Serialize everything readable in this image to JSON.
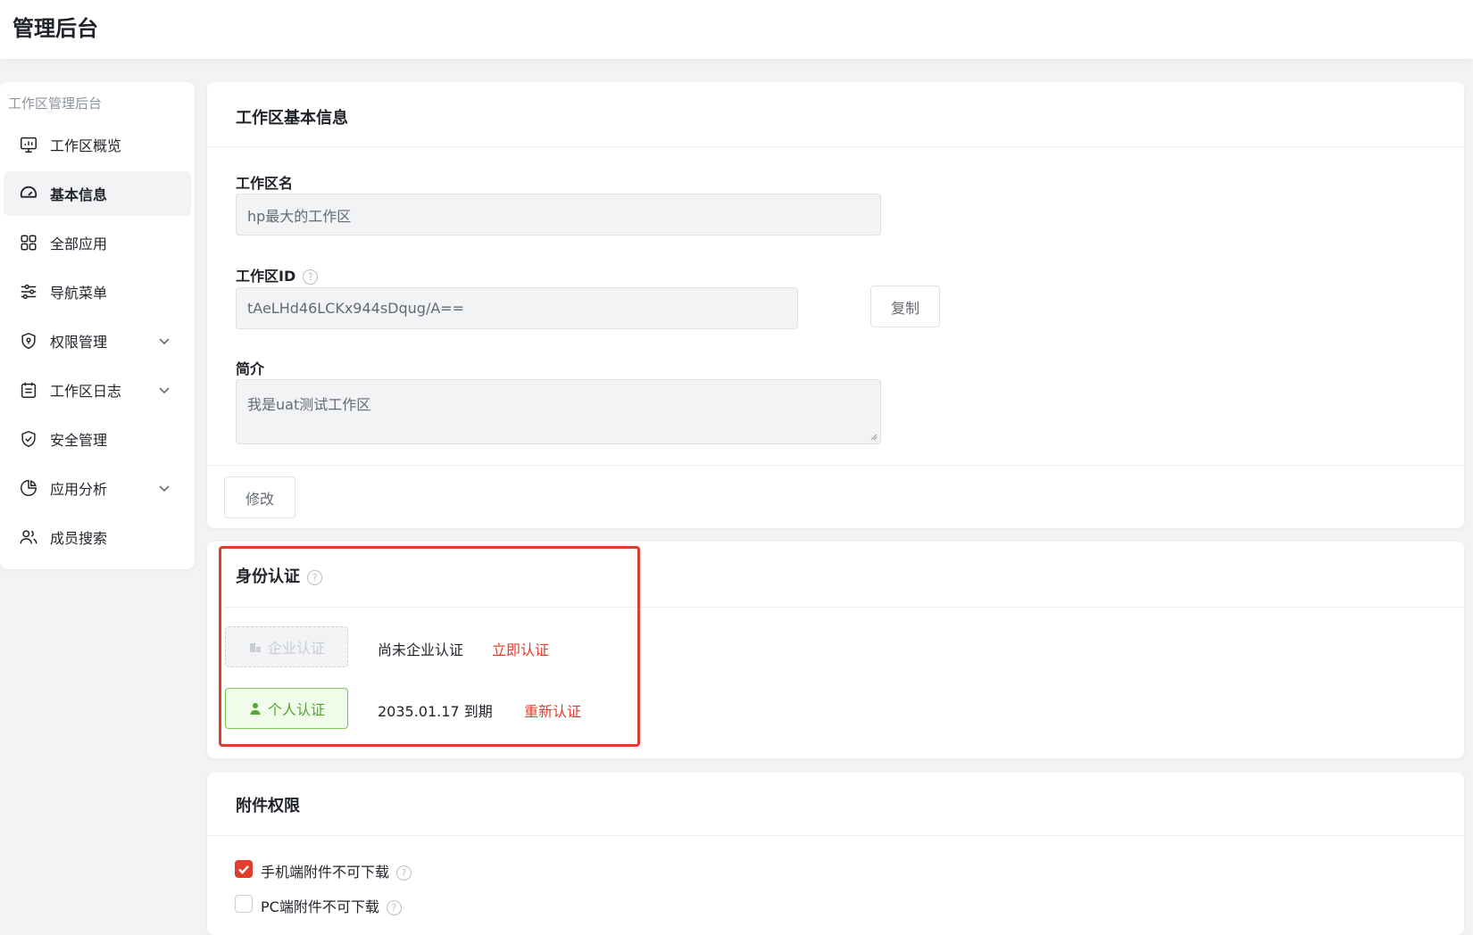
{
  "app": {
    "title": "管理后台"
  },
  "sidebar": {
    "group_label": "工作区管理后台",
    "items": [
      {
        "label": "工作区概览",
        "icon": "monitor-chart-icon"
      },
      {
        "label": "基本信息",
        "icon": "dashboard-gauge-icon",
        "active": true
      },
      {
        "label": "全部应用",
        "icon": "grid-apps-icon"
      },
      {
        "label": "导航菜单",
        "icon": "sliders-icon"
      },
      {
        "label": "权限管理",
        "icon": "shield-lock-icon",
        "expandable": true
      },
      {
        "label": "工作区日志",
        "icon": "calendar-log-icon",
        "expandable": true
      },
      {
        "label": "安全管理",
        "icon": "shield-check-icon"
      },
      {
        "label": "应用分析",
        "icon": "pie-chart-icon",
        "expandable": true
      },
      {
        "label": "成员搜索",
        "icon": "users-icon"
      }
    ]
  },
  "basic_info": {
    "title": "工作区基本信息",
    "name_label": "工作区名",
    "name_value": "hp最大的工作区",
    "id_label": "工作区ID",
    "id_value": "tAeLHd46LCKx944sDqug/A==",
    "copy_label": "复制",
    "intro_label": "简介",
    "intro_value": "我是uat测试工作区",
    "edit_label": "修改"
  },
  "identity": {
    "title": "身份认证",
    "enterprise_button": "企业认证",
    "enterprise_status": "尚未企业认证",
    "enterprise_action": "立即认证",
    "personal_button": "个人认证",
    "personal_status": "2035.01.17 到期",
    "personal_action": "重新认证"
  },
  "attachments": {
    "title": "附件权限",
    "options": [
      {
        "label": "手机端附件不可下载",
        "checked": true
      },
      {
        "label": "PC端附件不可下载",
        "checked": false
      }
    ]
  },
  "colors": {
    "accent_red": "#e03e2d",
    "success_green": "#52a831"
  }
}
